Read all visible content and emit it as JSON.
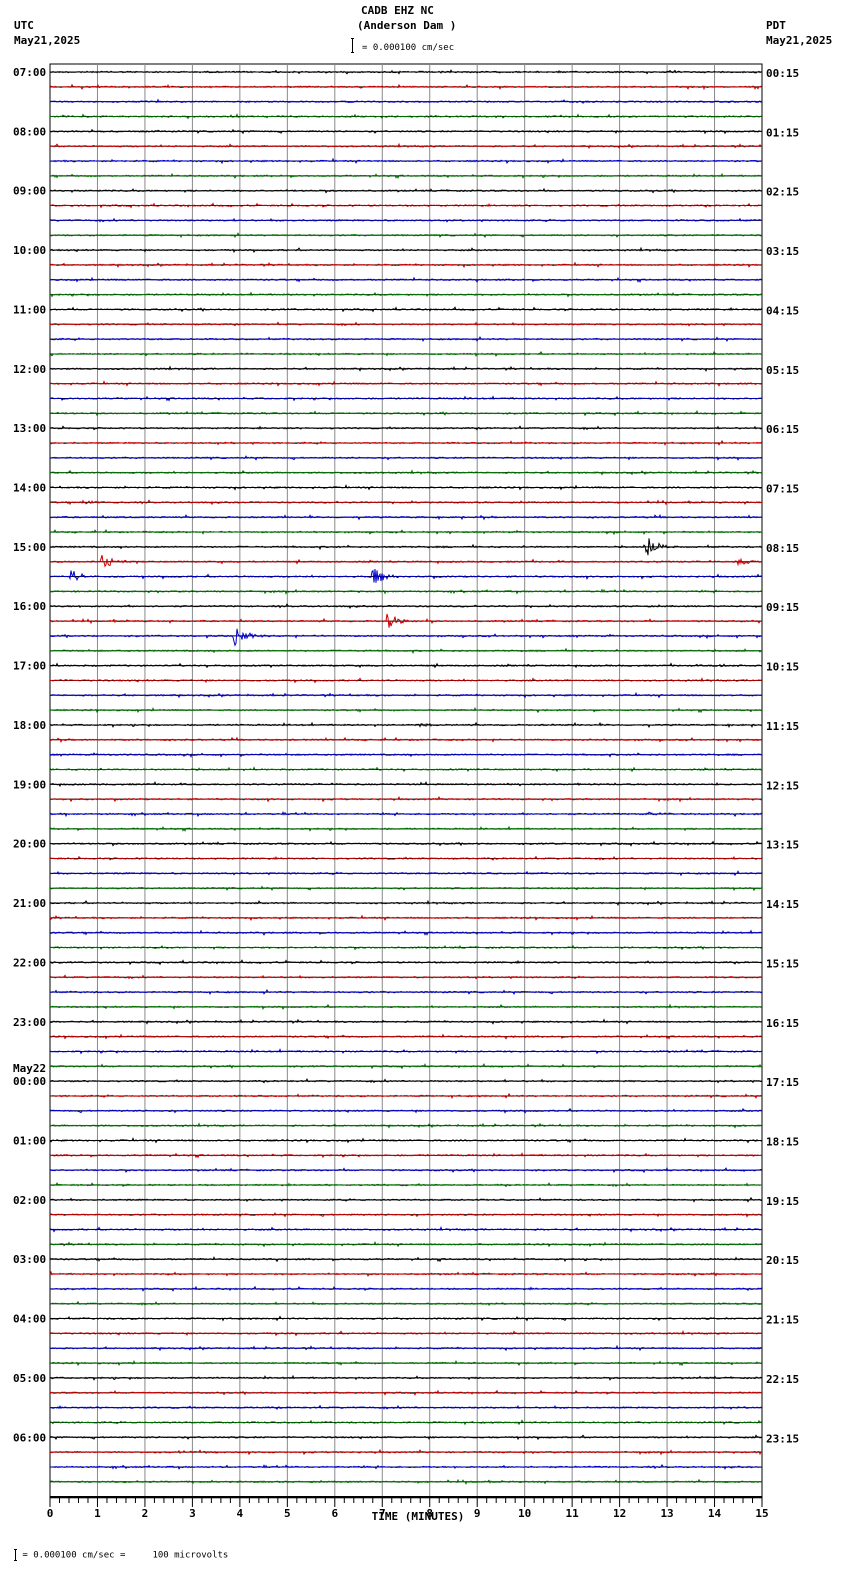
{
  "header": {
    "title": "CADB EHZ NC",
    "subtitle": "(Anderson Dam )",
    "scale": "= 0.000100 cm/sec",
    "left_tz": "UTC",
    "left_date": "May21,2025",
    "right_tz": "PDT",
    "right_date": "May21,2025"
  },
  "footer": {
    "scale_note": "= 0.000100 cm/sec =     100 microvolts"
  },
  "chart_data": {
    "type": "line",
    "title": "CADB EHZ NC (Anderson Dam )",
    "xlabel": "TIME (MINUTES)",
    "xlim": [
      0,
      15
    ],
    "x_ticks": [
      "0",
      "1",
      "2",
      "3",
      "4",
      "5",
      "6",
      "7",
      "8",
      "9",
      "10",
      "11",
      "12",
      "13",
      "14",
      "15"
    ],
    "trace_count": 96,
    "trace_minutes": 15,
    "trace_colors": [
      "#000000",
      "#cc0000",
      "#0000cc",
      "#007700"
    ],
    "left_labels": [
      "07:00",
      "08:00",
      "09:00",
      "10:00",
      "11:00",
      "12:00",
      "13:00",
      "14:00",
      "15:00",
      "16:00",
      "17:00",
      "18:00",
      "19:00",
      "20:00",
      "21:00",
      "22:00",
      "23:00",
      "00:00",
      "01:00",
      "02:00",
      "03:00",
      "04:00",
      "05:00",
      "06:00"
    ],
    "date_change_label": "May22",
    "right_labels": [
      "00:15",
      "01:15",
      "02:15",
      "03:15",
      "04:15",
      "05:15",
      "06:15",
      "07:15",
      "08:15",
      "09:15",
      "10:15",
      "11:15",
      "12:15",
      "13:15",
      "14:15",
      "15:15",
      "16:15",
      "17:15",
      "18:15",
      "19:15",
      "20:15",
      "21:15",
      "22:15",
      "23:15"
    ],
    "events": [
      {
        "trace": 29,
        "minute": 0.7,
        "amplitude": 3
      },
      {
        "trace": 32,
        "minute": 12.55,
        "amplitude": 12
      },
      {
        "trace": 33,
        "minute": 1.1,
        "amplitude": 9
      },
      {
        "trace": 33,
        "minute": 14.5,
        "amplitude": 4
      },
      {
        "trace": 34,
        "minute": 0.45,
        "amplitude": 7
      },
      {
        "trace": 34,
        "minute": 6.8,
        "amplitude": 11
      },
      {
        "trace": 37,
        "minute": 7.1,
        "amplitude": 10
      },
      {
        "trace": 38,
        "minute": 3.9,
        "amplitude": 10
      },
      {
        "trace": 40,
        "minute": 14.1,
        "amplitude": 2
      },
      {
        "trace": 44,
        "minute": 7.8,
        "amplitude": 2
      },
      {
        "trace": 50,
        "minute": 12.6,
        "amplitude": 2
      },
      {
        "trace": 93,
        "minute": 2.7,
        "amplitude": 2
      }
    ]
  }
}
